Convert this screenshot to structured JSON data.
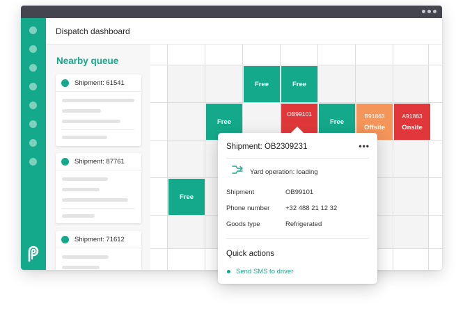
{
  "colors": {
    "brand": "#14a98a",
    "free": "#14a98a",
    "offsite": "#f4955a",
    "onsite": "#e0383a",
    "titlebar": "#45454d"
  },
  "header": {
    "title": "Dispatch dashboard"
  },
  "queue": {
    "title": "Nearby queue",
    "cards": [
      {
        "label": "Shipment: 61541"
      },
      {
        "label": "Shipment:  87761"
      },
      {
        "label": "Shipment: 71612"
      }
    ]
  },
  "grid": {
    "cells": [
      {
        "text": "Free",
        "status": "free"
      },
      {
        "text": "Free",
        "status": "free"
      },
      {
        "text": "Free",
        "status": "free"
      },
      {
        "code": "OB99101",
        "text": "",
        "status": "onsite",
        "selected": true
      },
      {
        "text": "Free",
        "status": "free"
      },
      {
        "code": "B91863",
        "text": "Offsite",
        "status": "offsite"
      },
      {
        "code": "A91863",
        "text": "Onsite",
        "status": "onsite"
      },
      {
        "text": "Free",
        "status": "free"
      }
    ]
  },
  "popup": {
    "title": "Shipment: OB2309231",
    "more_icon": "more-horizontal-icon",
    "yard_operation": "Yard operation: loading",
    "fields": [
      {
        "label": "Shipment",
        "value": "OB99101"
      },
      {
        "label": "Phone number",
        "value": "+32 488 21 12 32"
      },
      {
        "label": "Goods type",
        "value": "Refrigerated"
      }
    ],
    "quick_actions": {
      "title": "Quick actions",
      "items": [
        {
          "label": "Send SMS to driver"
        }
      ]
    }
  }
}
